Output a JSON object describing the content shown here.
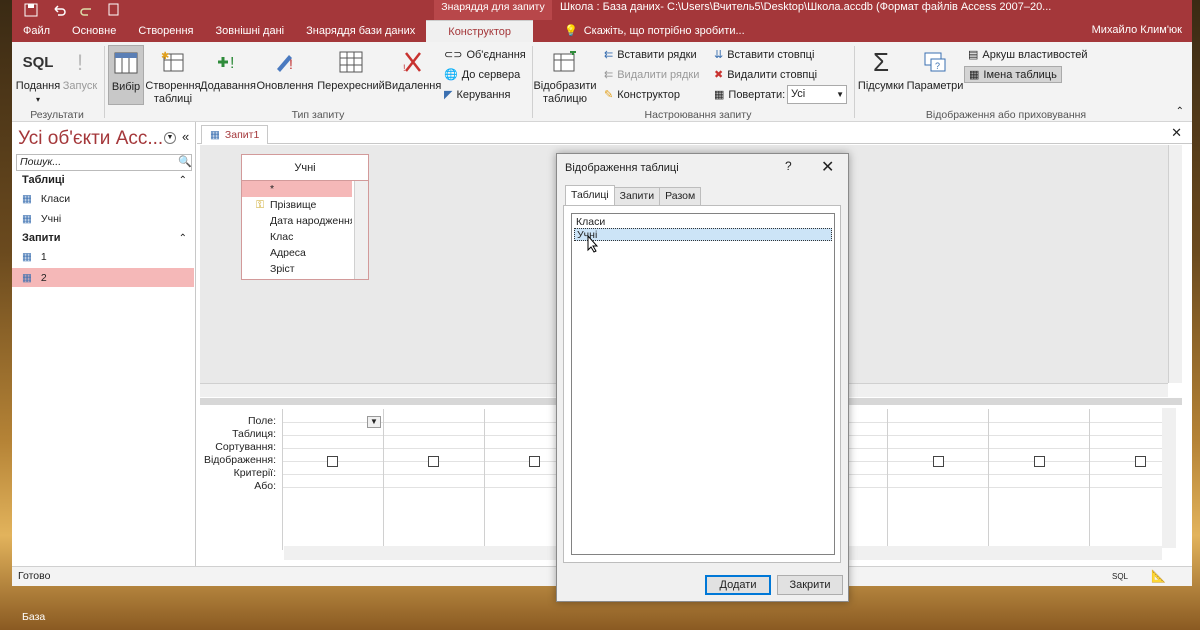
{
  "titlebar": {
    "context_header": "Знаряддя для запиту",
    "window_title": "Школа : База даних- C:\\Users\\Вчитель5\\Desktop\\Школа.accdb (Формат файлів Access 2007–20...",
    "tabs": [
      "Файл",
      "Основне",
      "Створення",
      "Зовнішні дані",
      "Знаряддя бази даних",
      "Конструктор"
    ],
    "active_tab": "Конструктор",
    "tell_me": "Скажіть, що потрібно зробити...",
    "user": "Михайло Клим'юк"
  },
  "ribbon": {
    "results": {
      "sql": "SQL",
      "view": "Подання",
      "run": "Запуск",
      "group": "Результати"
    },
    "query_type": {
      "select": "Вибір",
      "make_table": "Створення таблиці",
      "append": "Додавання",
      "update": "Оновлення",
      "crosstab": "Перехресний",
      "delete": "Видалення",
      "union": "Об'єднання",
      "pass_through": "До сервера",
      "data_definition": "Керування",
      "group": "Тип запиту"
    },
    "setup": {
      "show_table": "Відобразити таблицю",
      "insert_rows": "Вставити рядки",
      "delete_rows": "Видалити рядки",
      "builder": "Конструктор",
      "insert_columns": "Вставити стовпці",
      "delete_columns": "Видалити стовпці",
      "return_label": "Повертати:",
      "return_value": "Усі",
      "group": "Настроювання запиту"
    },
    "showhide": {
      "totals": "Підсумки",
      "parameters": "Параметри",
      "property_sheet": "Аркуш властивостей",
      "table_names": "Імена таблиць",
      "group": "Відображення або приховування"
    }
  },
  "nav": {
    "title": "Усі об'єкти Acc...",
    "search_placeholder": "Пошук...",
    "sections": [
      {
        "label": "Таблиці",
        "items": [
          "Класи",
          "Учні"
        ]
      },
      {
        "label": "Запити",
        "items": [
          "1",
          "2"
        ]
      }
    ]
  },
  "document": {
    "tab": "Запит1",
    "table": {
      "name": "Учні",
      "fields": [
        "*",
        "Прізвище",
        "Дата народження",
        "Клас",
        "Адреса",
        "Зріст"
      ]
    },
    "grid_labels": [
      "Поле:",
      "Таблиця:",
      "Сортування:",
      "Відображення:",
      "Критерії:",
      "Або:"
    ]
  },
  "status": {
    "text": "Готово",
    "sql": "SQL"
  },
  "dialog": {
    "title": "Відображення таблиці",
    "help": "?",
    "tabs": [
      "Таблиці",
      "Запити",
      "Разом"
    ],
    "items": [
      "Класи",
      "Учні"
    ],
    "selected": "Учні",
    "add_button": "Додати",
    "close_button": "Закрити"
  },
  "desktop": {
    "label": "База"
  },
  "colors": {
    "accent": "#a4373a",
    "selection": "#f5b8b8",
    "list_selection": "#cce4f7"
  }
}
